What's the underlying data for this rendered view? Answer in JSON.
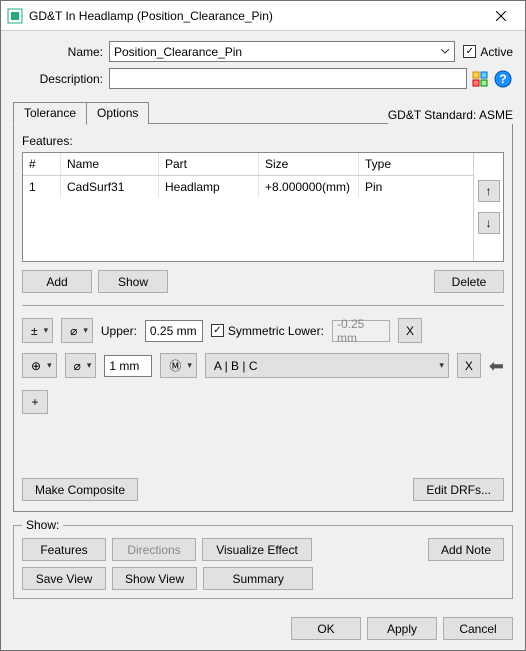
{
  "window": {
    "title": "GD&T In Headlamp (Position_Clearance_Pin)"
  },
  "form": {
    "name_label": "Name:",
    "name_value": "Position_Clearance_Pin",
    "active_label": "Active",
    "active_checked": true,
    "desc_label": "Description:",
    "desc_value": ""
  },
  "tabs": {
    "tolerance": "Tolerance",
    "options": "Options",
    "active": "tolerance"
  },
  "standard_label": "GD&T Standard: ASME",
  "features": {
    "label": "Features:",
    "headers": {
      "idx": "#",
      "name": "Name",
      "part": "Part",
      "size": "Size",
      "type": "Type"
    },
    "rows": [
      {
        "idx": "1",
        "name": "CadSurf31",
        "part": "Headlamp",
        "size": "+8.000000(mm)",
        "type": "Pin"
      }
    ],
    "buttons": {
      "add": "Add",
      "show": "Show",
      "delete": "Delete",
      "up": "↑",
      "down": "↓"
    }
  },
  "tol_row1": {
    "sym1": "±",
    "sym2": "⌀",
    "upper_label": "Upper:",
    "upper_value": "0.25 mm",
    "sym_lower_label": "Symmetric Lower:",
    "sym_lower_checked": true,
    "lower_value": "-0.25 mm",
    "x": "X"
  },
  "tol_row2": {
    "sym1": "⊕",
    "sym2": "⌀",
    "value": "1 mm",
    "modifier": "Ⓜ",
    "datums": "A | B | C",
    "x": "X",
    "plus": "+"
  },
  "composite": {
    "make": "Make Composite",
    "edit_drfs": "Edit DRFs..."
  },
  "show_group": {
    "legend": "Show:",
    "features": "Features",
    "directions": "Directions",
    "visualize": "Visualize Effect",
    "save_view": "Save View",
    "show_view": "Show View",
    "summary": "Summary",
    "add_note": "Add Note"
  },
  "dialog": {
    "ok": "OK",
    "apply": "Apply",
    "cancel": "Cancel"
  }
}
